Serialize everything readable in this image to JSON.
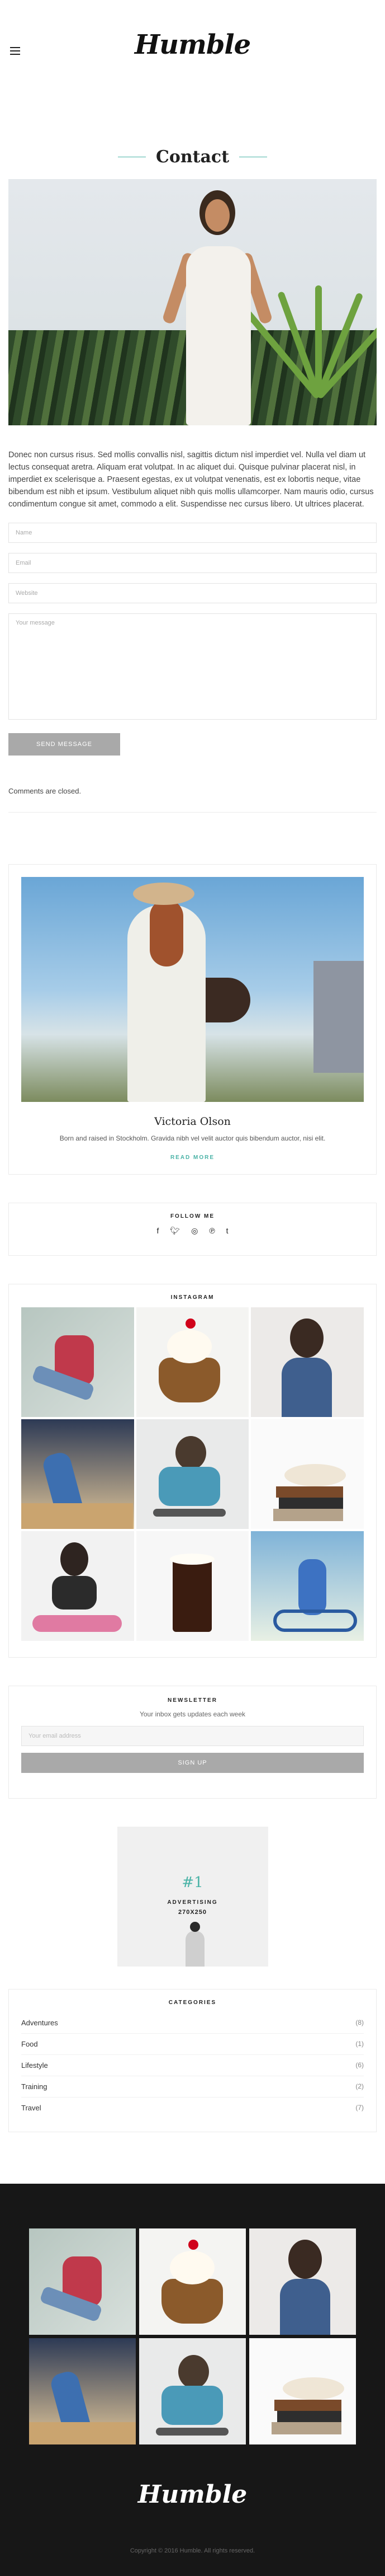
{
  "header": {
    "logo": "Humble",
    "menu_icon": "hamburger-menu-icon"
  },
  "page": {
    "title": "Contact"
  },
  "content": {
    "paragraph": "Donec non cursus risus. Sed mollis convallis nisl, sagittis dictum nisl imperdiet vel. Nulla vel diam ut lectus consequat aretra. Aliquam erat volutpat. In ac aliquet dui. Quisque pulvinar placerat nisl, in imperdiet ex scelerisque a. Praesent egestas, ex ut volutpat venenatis, est ex lobortis neque, vitae bibendum est nibh et ipsum. Vestibulum aliquet nibh quis mollis ullamcorper. Nam mauris odio, cursus condimentum congue sit amet, commodo a elit. Suspendisse nec cursus libero. Ut ultrices placerat."
  },
  "form": {
    "name_placeholder": "Name",
    "email_placeholder": "Email",
    "website_placeholder": "Website",
    "message_placeholder": "Your message",
    "send_label": "SEND MESSAGE"
  },
  "comments": {
    "closed_text": "Comments are closed."
  },
  "about": {
    "name": "Victoria Olson",
    "bio": "Born and raised in Stockholm. Gravida nibh vel velit auctor quis bibendum auctor, nisi elit.",
    "read_more": "READ MORE"
  },
  "follow": {
    "title": "FOLLOW ME",
    "icons": [
      "facebook-icon",
      "twitter-icon",
      "instagram-icon",
      "pinterest-icon",
      "tumblr-icon"
    ],
    "glyphs": [
      "f",
      "•",
      "◎",
      "℗",
      "t"
    ]
  },
  "instagram": {
    "title": "INSTAGRAM"
  },
  "newsletter": {
    "title": "NEWSLETTER",
    "subtitle": "Your inbox gets updates each week",
    "email_placeholder": "Your email address",
    "signup_label": "SIGN UP"
  },
  "ad": {
    "number": "#1",
    "label": "ADVERTISING",
    "size": "270X250"
  },
  "categories": {
    "title": "CATEGORIES",
    "items": [
      {
        "label": "Adventures",
        "count": "(8)"
      },
      {
        "label": "Food",
        "count": "(1)"
      },
      {
        "label": "Lifestyle",
        "count": "(6)"
      },
      {
        "label": "Training",
        "count": "(2)"
      },
      {
        "label": "Travel",
        "count": "(7)"
      }
    ]
  },
  "footer": {
    "logo": "Humble",
    "copyright": "Copyright © 2016 Humble. All rights reserved."
  },
  "colors": {
    "accent": "#4bb3a7",
    "button": "#a9a9a9",
    "footer_bg": "#171717"
  }
}
